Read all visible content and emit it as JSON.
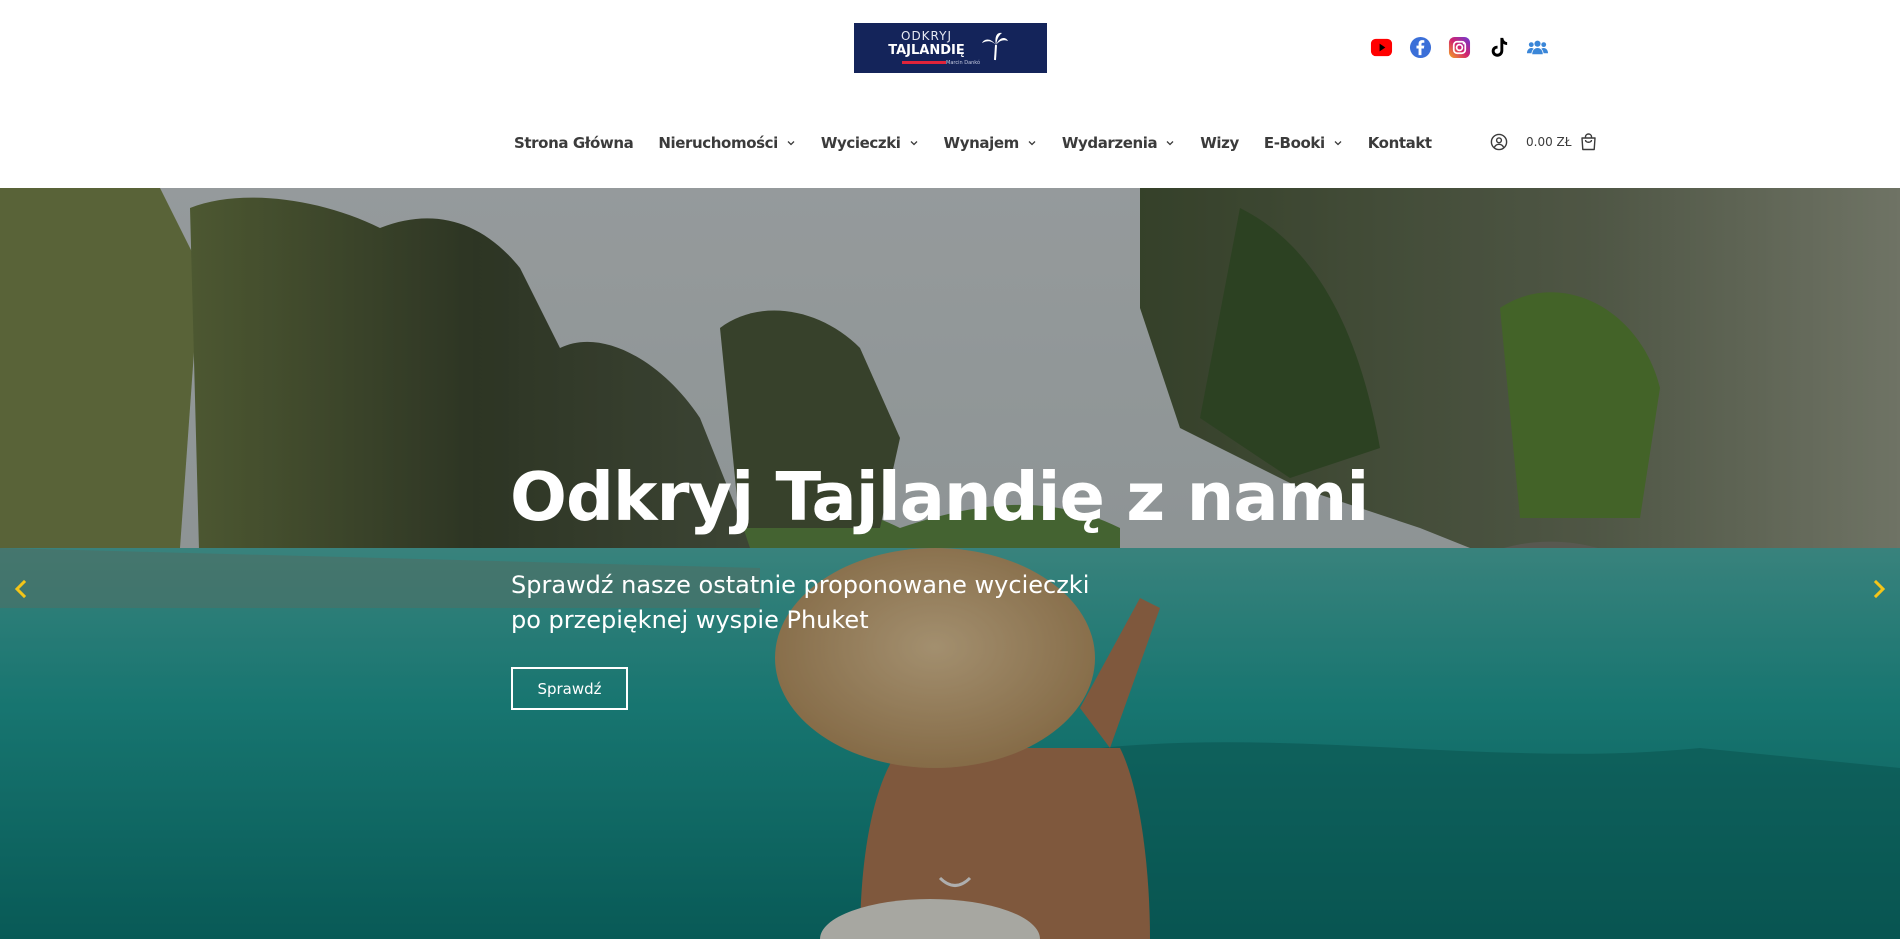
{
  "logo": {
    "line1": "ODKRYJ",
    "line2": "TAJLANDIĘ",
    "line3": "Marcin Dankó"
  },
  "social": [
    {
      "name": "youtube-icon",
      "color": "#ff0000"
    },
    {
      "name": "facebook-icon",
      "color": "#3b6fd8"
    },
    {
      "name": "instagram-icon",
      "color": "#d1226e"
    },
    {
      "name": "tiktok-icon",
      "color": "#000000"
    },
    {
      "name": "group-icon",
      "color": "#3a86d8"
    }
  ],
  "nav": {
    "items": [
      {
        "label": "Strona Główna",
        "dropdown": false
      },
      {
        "label": "Nieruchomości",
        "dropdown": true
      },
      {
        "label": "Wycieczki",
        "dropdown": true
      },
      {
        "label": "Wynajem",
        "dropdown": true
      },
      {
        "label": "Wydarzenia",
        "dropdown": true
      },
      {
        "label": "Wizy",
        "dropdown": false
      },
      {
        "label": "E-Booki",
        "dropdown": true
      },
      {
        "label": "Kontakt",
        "dropdown": false
      }
    ],
    "cart_total": "0.00 ZŁ"
  },
  "hero": {
    "title": "Odkryj Tajlandię z nami",
    "subtitle_line1": "Sprawdź nasze ostatnie proponowane wycieczki",
    "subtitle_line2": "po przepięknej wyspie Phuket",
    "button_label": "Sprawdź"
  },
  "colors": {
    "logo_bg": "#14245a",
    "nav_text": "#3b3b3b",
    "slider_arrow": "#f5c518"
  }
}
